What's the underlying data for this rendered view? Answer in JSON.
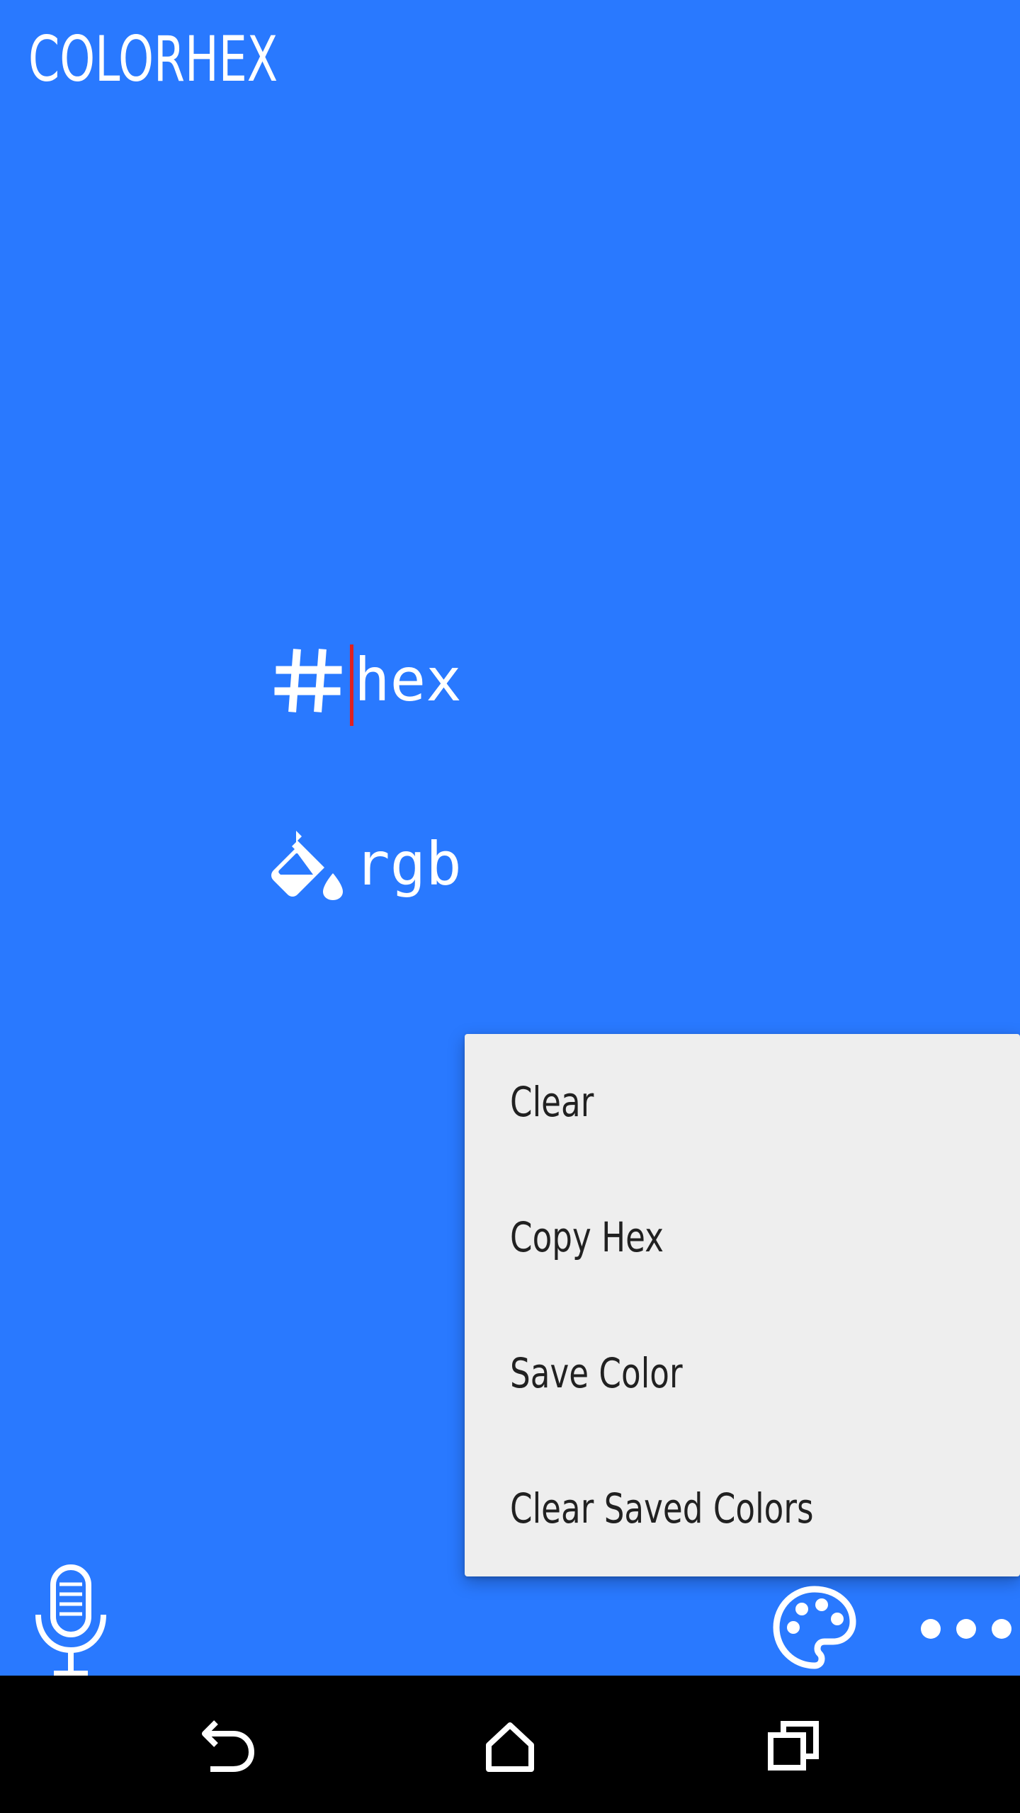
{
  "app": {
    "title": "COLORHEX",
    "background_color": "#2979ff"
  },
  "fields": {
    "hex": {
      "icon": "hash-icon",
      "placeholder": "hex",
      "value": ""
    },
    "rgb": {
      "icon": "paint-bucket-icon",
      "placeholder": "rgb",
      "value": ""
    }
  },
  "menu": {
    "items": [
      {
        "label": "Clear"
      },
      {
        "label": "Copy Hex"
      },
      {
        "label": "Save Color"
      },
      {
        "label": "Clear Saved Colors"
      }
    ]
  },
  "bottom_bar": {
    "left_icon": "microphone-icon",
    "right_icons": [
      "palette-icon",
      "more-horizontal-icon"
    ]
  },
  "system_nav": {
    "buttons": [
      "back-icon",
      "home-icon",
      "recents-icon"
    ]
  }
}
